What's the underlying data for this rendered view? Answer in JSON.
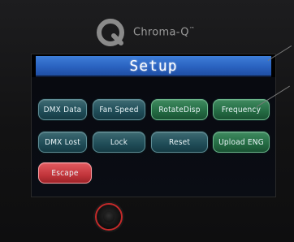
{
  "brand": {
    "name": "Chroma-Q",
    "trademark": "™"
  },
  "screen": {
    "title": "Setup",
    "buttons": {
      "dmx_data": "DMX Data",
      "fan_speed": "Fan Speed",
      "rotate_disp": "RotateDisp",
      "frequency": "Frequency",
      "dmx_lost": "DMX Lost",
      "lock": "Lock",
      "reset": "Reset",
      "upload_eng": "Upload ENG",
      "escape": "Escape"
    }
  },
  "colors": {
    "title_bar": "#2a62c0",
    "button_teal": "#1f4c57",
    "button_green": "#236a42",
    "button_escape": "#c2353b",
    "knob_ring": "#c42a2a"
  }
}
